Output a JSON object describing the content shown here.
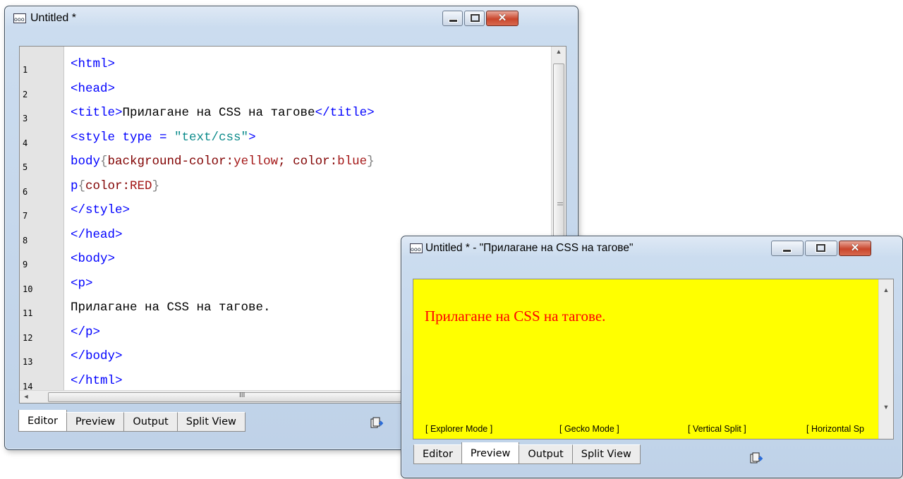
{
  "editor_window": {
    "title": "Untitled *",
    "line_numbers": [
      "1",
      "2",
      "3",
      "4",
      "5",
      "6",
      "7",
      "8",
      "9",
      "10",
      "11",
      "12",
      "13",
      "14"
    ],
    "code_lines": [
      [
        {
          "t": "<html>",
          "c": "tag"
        }
      ],
      [
        {
          "t": "<head>",
          "c": "tag"
        }
      ],
      [
        {
          "t": "<title>",
          "c": "tag"
        },
        {
          "t": "Прилагане на CSS на тагове",
          "c": "text"
        },
        {
          "t": "</title>",
          "c": "tag"
        }
      ],
      [
        {
          "t": "<style ",
          "c": "tag"
        },
        {
          "t": "type",
          "c": "tag"
        },
        {
          "t": " = ",
          "c": "tag"
        },
        {
          "t": "\"text/css\"",
          "c": "val"
        },
        {
          "t": ">",
          "c": "tag"
        }
      ],
      [
        {
          "t": "body",
          "c": "tag"
        },
        {
          "t": "{",
          "c": "brace"
        },
        {
          "t": "background-color:",
          "c": "prop"
        },
        {
          "t": "yellow",
          "c": "cssval"
        },
        {
          "t": "; ",
          "c": "prop"
        },
        {
          "t": "color:",
          "c": "prop"
        },
        {
          "t": "blue",
          "c": "cssval"
        },
        {
          "t": "}",
          "c": "brace"
        }
      ],
      [
        {
          "t": "p",
          "c": "tag"
        },
        {
          "t": "{",
          "c": "brace"
        },
        {
          "t": "color:",
          "c": "prop"
        },
        {
          "t": "RED",
          "c": "cssval"
        },
        {
          "t": "}",
          "c": "brace"
        }
      ],
      [
        {
          "t": "</style>",
          "c": "tag"
        }
      ],
      [
        {
          "t": "</head>",
          "c": "tag"
        }
      ],
      [
        {
          "t": "<body>",
          "c": "tag"
        }
      ],
      [
        {
          "t": "<p>",
          "c": "tag"
        }
      ],
      [
        {
          "t": "Прилагане на CSS на тагове.",
          "c": "text"
        }
      ],
      [
        {
          "t": "</p>",
          "c": "tag"
        }
      ],
      [
        {
          "t": "</body>",
          "c": "tag"
        }
      ],
      [
        {
          "t": "</html>",
          "c": "tag"
        }
      ]
    ],
    "tabs": [
      {
        "label": "Editor",
        "active": true
      },
      {
        "label": "Preview",
        "active": false
      },
      {
        "label": "Output",
        "active": false
      },
      {
        "label": "Split View",
        "active": false
      }
    ],
    "scroll_glyph": "III"
  },
  "preview_window": {
    "title": "Untitled * - \"Прилагане на CSS на тагове\"",
    "content_text": "Прилагане на CSS на тагове.",
    "modes": [
      "[ Explorer Mode ]",
      "[ Gecko Mode ]",
      "[ Vertical Split ]",
      "[ Horizontal Sp"
    ],
    "tabs": [
      {
        "label": "Editor",
        "active": false
      },
      {
        "label": "Preview",
        "active": true
      },
      {
        "label": "Output",
        "active": false
      },
      {
        "label": "Split View",
        "active": false
      }
    ]
  },
  "colors": {
    "tag": "#0000ff",
    "text": "#000000",
    "val": "#0a8a8a",
    "prop": "#800000",
    "cssval": "#a31515",
    "brace": "#808080",
    "preview_bg": "#ffff00",
    "preview_text": "#ff0000"
  },
  "icons": {
    "app": "app-window-icon",
    "tab_action": "copy-export-icon"
  }
}
